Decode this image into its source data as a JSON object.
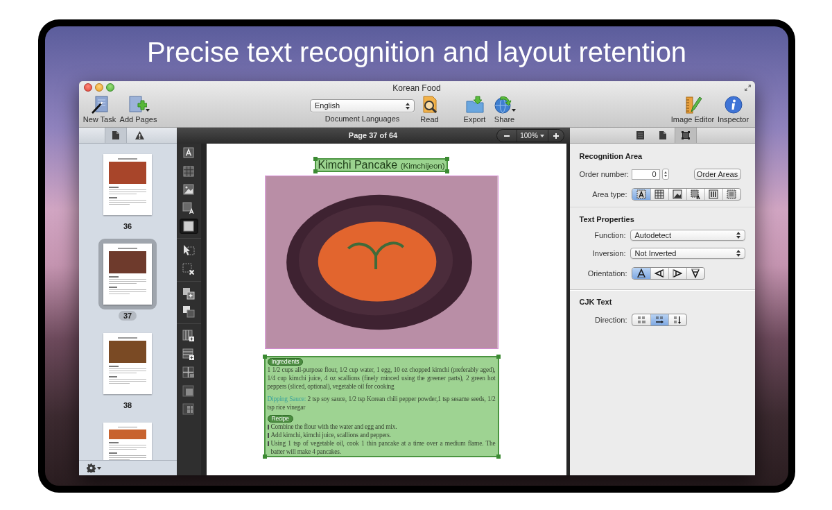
{
  "headline": "Precise text recognition and layout retention",
  "window": {
    "title": "Korean Food"
  },
  "toolbar": {
    "left_buttons": [
      {
        "label": "New Task",
        "menu": false
      },
      {
        "label": "Add Pages",
        "menu": true
      }
    ],
    "language": {
      "value": "English",
      "caption": "Document Languages"
    },
    "center_buttons": [
      {
        "label": "Read",
        "menu": false
      },
      {
        "label": "Export",
        "menu": false
      },
      {
        "label": "Share",
        "menu": true
      }
    ],
    "right_buttons": [
      {
        "label": "Image Editor",
        "menu": false
      },
      {
        "label": "Inspector",
        "menu": false
      }
    ]
  },
  "sidebar": {
    "tabs": [
      {
        "selected": true
      },
      {
        "selected": false
      }
    ],
    "pages": [
      {
        "number": "36",
        "selected": false
      },
      {
        "number": "37",
        "selected": true
      },
      {
        "number": "38",
        "selected": false
      },
      {
        "selected": false
      }
    ]
  },
  "tool_groups": [
    [
      {
        "selected": false
      },
      {
        "selected": false
      },
      {
        "selected": false
      },
      {
        "selected": false
      },
      {
        "selected": true
      }
    ],
    [
      {
        "selected": false
      },
      {
        "selected": false
      }
    ],
    [
      {
        "selected": false
      },
      {
        "selected": false
      }
    ],
    [
      {
        "selected": false
      },
      {
        "selected": false
      },
      {
        "selected": false
      },
      {
        "selected": false
      },
      {
        "selected": false
      }
    ]
  ],
  "page_bar": {
    "page": "Page 37 of 64",
    "zoom": "100%"
  },
  "document": {
    "title": "Kimchi Pancake",
    "subtitle": "(Kimchijeon)",
    "ingredients_tag": "Ingredients",
    "ingredients": "1 1/2 cups all-purpose flour, 1/2 cup water, 1 egg, 10 oz chopped kimchi (preferably aged), 1/4 cup kimchi juice, 4 oz scallions (finely minced using the greener parts), 2 green hot peppers (sliced, optional), vegetable oil for cooking",
    "sauce_label": "Dipping Sauce:",
    "sauce": "2 tsp soy sauce, 1/2 tsp Korean chili pepper powder,1 tsp sesame seeds, 1/2 tsp rice vinegar",
    "recipe_tag": "Recipe",
    "steps": [
      "Combine the flour with the water and egg and mix.",
      "Add kimchi, kimchi juice, scallions and peppers.",
      "Using 1 tsp of vegetable oil, cook 1 thin pancake at a time over a medium flame. The batter will make 4 pancakes."
    ]
  },
  "inspector": {
    "tabs": [
      {
        "selected": false
      },
      {
        "selected": false
      },
      {
        "selected": true
      }
    ],
    "recognition_area": {
      "title": "Recognition Area",
      "order_label": "Order number:",
      "order_value": "0",
      "order_button": "Order Areas",
      "area_type_label": "Area type:",
      "area_types": [
        {
          "selected": true
        },
        {
          "selected": false
        },
        {
          "selected": false
        },
        {
          "selected": false
        },
        {
          "selected": false
        },
        {
          "selected": false
        }
      ]
    },
    "text_properties": {
      "title": "Text Properties",
      "function_label": "Function:",
      "function_value": "Autodetect",
      "inversion_label": "Inversion:",
      "inversion_value": "Not Inverted",
      "orientation_label": "Orientation:",
      "orientations": [
        {
          "selected": true
        },
        {
          "selected": false
        },
        {
          "selected": false
        },
        {
          "selected": false
        }
      ]
    },
    "cjk_text": {
      "title": "CJK Text",
      "direction_label": "Direction:",
      "directions": [
        {
          "selected": false
        },
        {
          "selected": true
        },
        {
          "selected": false
        }
      ]
    }
  }
}
